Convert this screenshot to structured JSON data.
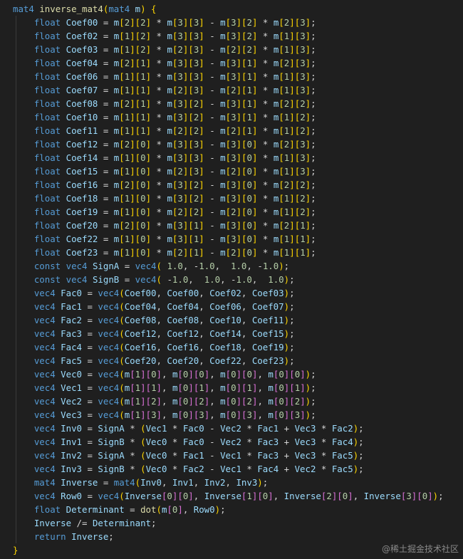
{
  "editor": {
    "lines": [
      "mat4 inverse_mat4(mat4 m) {",
      "    float Coef00 = m[2][2] * m[3][3] - m[3][2] * m[2][3];",
      "    float Coef02 = m[1][2] * m[3][3] - m[3][2] * m[1][3];",
      "    float Coef03 = m[1][2] * m[2][3] - m[2][2] * m[1][3];",
      "    float Coef04 = m[2][1] * m[3][3] - m[3][1] * m[2][3];",
      "    float Coef06 = m[1][1] * m[3][3] - m[3][1] * m[1][3];",
      "    float Coef07 = m[1][1] * m[2][3] - m[2][1] * m[1][3];",
      "    float Coef08 = m[2][1] * m[3][2] - m[3][1] * m[2][2];",
      "    float Coef10 = m[1][1] * m[3][2] - m[3][1] * m[1][2];",
      "    float Coef11 = m[1][1] * m[2][2] - m[2][1] * m[1][2];",
      "    float Coef12 = m[2][0] * m[3][3] - m[3][0] * m[2][3];",
      "    float Coef14 = m[1][0] * m[3][3] - m[3][0] * m[1][3];",
      "    float Coef15 = m[1][0] * m[2][3] - m[2][0] * m[1][3];",
      "    float Coef16 = m[2][0] * m[3][2] - m[3][0] * m[2][2];",
      "    float Coef18 = m[1][0] * m[3][2] - m[3][0] * m[1][2];",
      "    float Coef19 = m[1][0] * m[2][2] - m[2][0] * m[1][2];",
      "    float Coef20 = m[2][0] * m[3][1] - m[3][0] * m[2][1];",
      "    float Coef22 = m[1][0] * m[3][1] - m[3][0] * m[1][1];",
      "    float Coef23 = m[1][0] * m[2][1] - m[2][0] * m[1][1];",
      "    const vec4 SignA = vec4( 1.0, -1.0,  1.0, -1.0);",
      "    const vec4 SignB = vec4( -1.0,  1.0, -1.0,  1.0);",
      "    vec4 Fac0 = vec4(Coef00, Coef00, Coef02, Coef03);",
      "    vec4 Fac1 = vec4(Coef04, Coef04, Coef06, Coef07);",
      "    vec4 Fac2 = vec4(Coef08, Coef08, Coef10, Coef11);",
      "    vec4 Fac3 = vec4(Coef12, Coef12, Coef14, Coef15);",
      "    vec4 Fac4 = vec4(Coef16, Coef16, Coef18, Coef19);",
      "    vec4 Fac5 = vec4(Coef20, Coef20, Coef22, Coef23);",
      "    vec4 Vec0 = vec4(m[1][0], m[0][0], m[0][0], m[0][0]);",
      "    vec4 Vec1 = vec4(m[1][1], m[0][1], m[0][1], m[0][1]);",
      "    vec4 Vec2 = vec4(m[1][2], m[0][2], m[0][2], m[0][2]);",
      "    vec4 Vec3 = vec4(m[1][3], m[0][3], m[0][3], m[0][3]);",
      "    vec4 Inv0 = SignA * (Vec1 * Fac0 - Vec2 * Fac1 + Vec3 * Fac2);",
      "    vec4 Inv1 = SignB * (Vec0 * Fac0 - Vec2 * Fac3 + Vec3 * Fac4);",
      "    vec4 Inv2 = SignA * (Vec0 * Fac1 - Vec1 * Fac3 + Vec3 * Fac5);",
      "    vec4 Inv3 = SignB * (Vec0 * Fac2 - Vec1 * Fac4 + Vec2 * Fac5);",
      "    mat4 Inverse = mat4(Inv0, Inv1, Inv2, Inv3);",
      "    vec4 Row0 = vec4(Inverse[0][0], Inverse[1][0], Inverse[2][0], Inverse[3][0]);",
      "    float Determinant = dot(m[0], Row0);",
      "    Inverse /= Determinant;",
      "    return Inverse;",
      "}"
    ]
  },
  "watermark": "@稀土掘金技术社区",
  "colors": {
    "background": "#1f1f1f",
    "keyword": "#569cd6",
    "function": "#dcdcaa",
    "variable": "#9cdcfe",
    "number": "#b5cea8",
    "bracket_1": "#ffd700",
    "bracket_2": "#da70d6",
    "bracket_3": "#179fff"
  }
}
